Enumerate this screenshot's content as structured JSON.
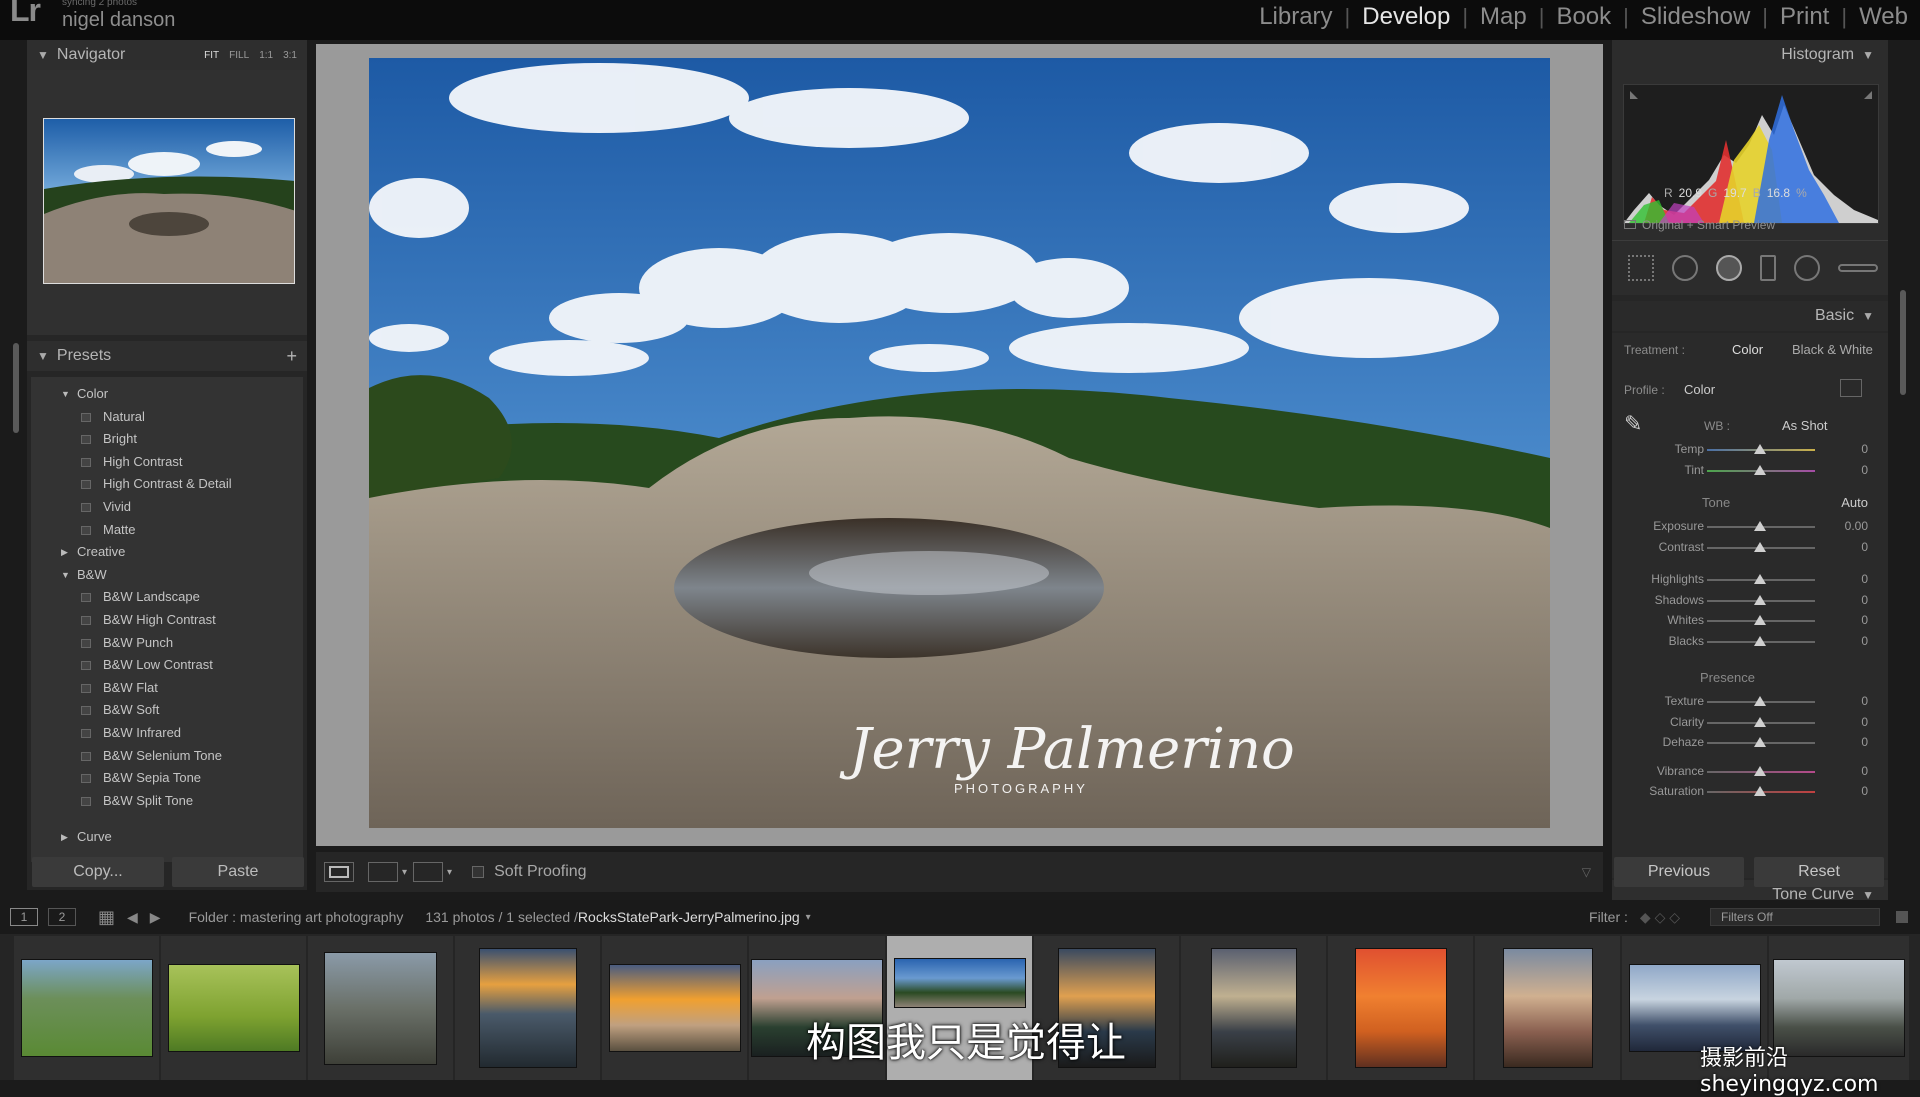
{
  "app": {
    "logo": "Lr",
    "identity_sub": "syncing 2 photos",
    "identity_name": "nigel danson"
  },
  "modules": [
    "Library",
    "Develop",
    "Map",
    "Book",
    "Slideshow",
    "Print",
    "Web"
  ],
  "active_module": "Develop",
  "navigator": {
    "title": "Navigator",
    "zoom_options": [
      "FIT",
      "FILL",
      "1:1",
      "3:1"
    ]
  },
  "presets": {
    "title": "Presets",
    "add": "+",
    "groups": [
      {
        "label": "Color",
        "expanded": true,
        "items": [
          "Natural",
          "Bright",
          "High Contrast",
          "High Contrast & Detail",
          "Vivid",
          "Matte"
        ]
      },
      {
        "label": "Creative",
        "expanded": false,
        "items": []
      },
      {
        "label": "B&W",
        "expanded": true,
        "items": [
          "B&W Landscape",
          "B&W High Contrast",
          "B&W Punch",
          "B&W Low Contrast",
          "B&W Flat",
          "B&W Soft",
          "B&W Infrared",
          "B&W Selenium Tone",
          "B&W Sepia Tone",
          "B&W Split Tone"
        ]
      },
      {
        "label": "Curve",
        "expanded": false,
        "items": []
      }
    ]
  },
  "left_buttons": {
    "copy": "Copy...",
    "paste": "Paste"
  },
  "toolbar": {
    "soft_proofing": "Soft Proofing"
  },
  "histogram": {
    "title": "Histogram",
    "r_label": "R",
    "r": "20.9",
    "g_label": "G",
    "g": "19.7",
    "b_label": "B",
    "b": "16.8",
    "unit": "%",
    "preview": "Original + Smart Preview"
  },
  "basic": {
    "title": "Basic",
    "treatment_label": "Treatment :",
    "treatment_color": "Color",
    "treatment_bw": "Black & White",
    "profile_label": "Profile :",
    "profile_value": "Color",
    "wb_label": "WB :",
    "wb_value": "As Shot",
    "tone_label": "Tone",
    "auto": "Auto",
    "presence_label": "Presence",
    "wb_sliders": [
      {
        "label": "Temp",
        "value": "0"
      },
      {
        "label": "Tint",
        "value": "0"
      }
    ],
    "tone_sliders": [
      {
        "label": "Exposure",
        "value": "0.00"
      },
      {
        "label": "Contrast",
        "value": "0"
      }
    ],
    "tone_sliders2": [
      {
        "label": "Highlights",
        "value": "0"
      },
      {
        "label": "Shadows",
        "value": "0"
      },
      {
        "label": "Whites",
        "value": "0"
      },
      {
        "label": "Blacks",
        "value": "0"
      }
    ],
    "presence_sliders": [
      {
        "label": "Texture",
        "value": "0"
      },
      {
        "label": "Clarity",
        "value": "0"
      },
      {
        "label": "Dehaze",
        "value": "0"
      }
    ],
    "presence_sliders2": [
      {
        "label": "Vibrance",
        "value": "0"
      },
      {
        "label": "Saturation",
        "value": "0"
      }
    ]
  },
  "tone_curve": {
    "title": "Tone Curve"
  },
  "right_buttons": {
    "previous": "Previous",
    "reset": "Reset"
  },
  "filmstrip_bar": {
    "view1": "1",
    "view2": "2",
    "folder": "Folder : mastering art photography",
    "count": "131 photos / 1 selected /",
    "filename": "RocksStatePark-JerryPalmerino.jpg",
    "filter_label": "Filter :",
    "filter_value": "Filters Off"
  },
  "subtitle": "构图我只是觉得让",
  "watermark": "摄影前沿 sheyingqyz.com",
  "photo_signature": "Jerry Palmerino",
  "photo_signature_sub": "PHOTOGRAPHY",
  "colors": {
    "accent": "#e6e6e6",
    "panel": "#262626",
    "center_bg": "#9a9a9a"
  }
}
